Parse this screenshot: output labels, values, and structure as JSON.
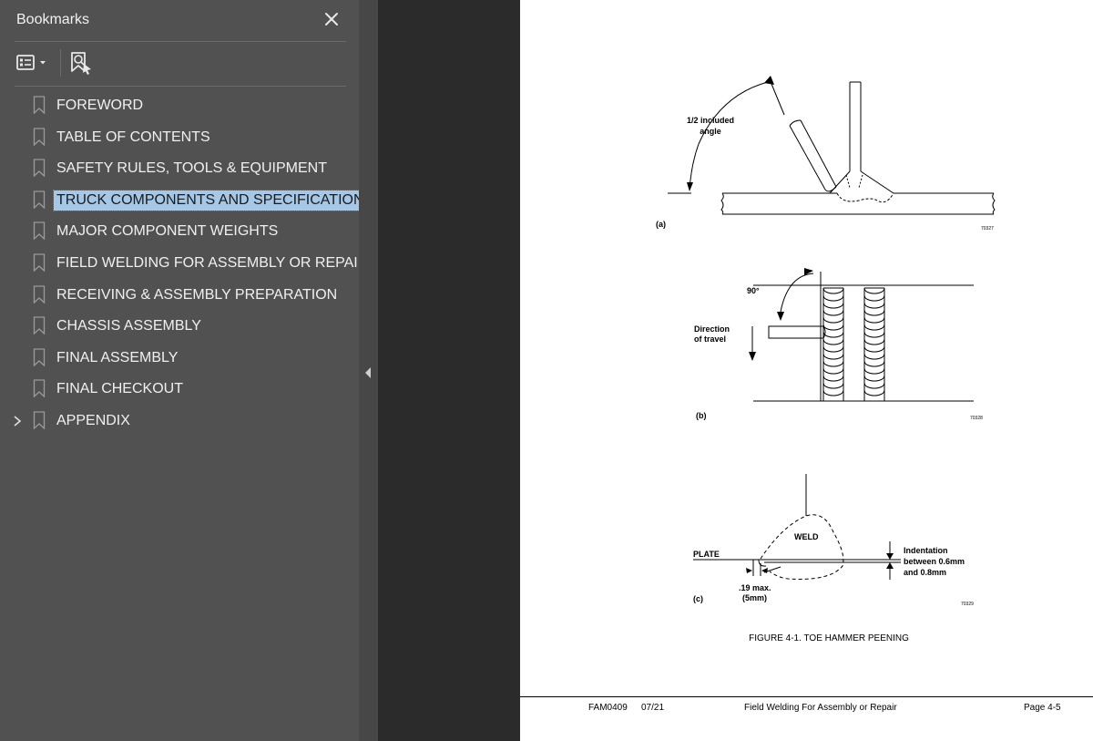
{
  "sidebar": {
    "title": "Bookmarks",
    "items": [
      {
        "label": "FOREWORD"
      },
      {
        "label": "TABLE OF CONTENTS"
      },
      {
        "label": "SAFETY RULES, TOOLS & EQUIPMENT"
      },
      {
        "label": "TRUCK COMPONENTS AND SPECIFICATIONS",
        "selected": true
      },
      {
        "label": "MAJOR COMPONENT WEIGHTS"
      },
      {
        "label": "FIELD WELDING FOR ASSEMBLY OR REPAIR"
      },
      {
        "label": "RECEIVING & ASSEMBLY PREPARATION"
      },
      {
        "label": "CHASSIS ASSEMBLY"
      },
      {
        "label": "FINAL ASSEMBLY"
      },
      {
        "label": "FINAL CHECKOUT"
      },
      {
        "label": "APPENDIX",
        "expandable": true
      }
    ]
  },
  "page": {
    "fig_a": {
      "angle_label_1": "1/2 included",
      "angle_label_2": "angle",
      "letter": "(a)",
      "code": "70327"
    },
    "fig_b": {
      "angle_label": "90°",
      "dir_label_1": "Direction",
      "dir_label_2": "of travel",
      "letter": "(b)",
      "code": "70328"
    },
    "fig_c": {
      "weld_label": "WELD",
      "plate_label": "PLATE",
      "indent_1": "Indentation",
      "indent_2": "between 0.6mm",
      "indent_3": "and 0.8mm",
      "max_1": ".19 max.",
      "max_2": "(5mm)",
      "letter": "(c)",
      "code": "70329"
    },
    "caption": "FIGURE 4-1. TOE HAMMER PEENING",
    "footer": {
      "doc_id": "FAM0409",
      "date": "07/21",
      "section": "Field Welding For Assembly or Repair",
      "page_num": "Page 4-5"
    }
  },
  "colors": {
    "sidebar_bg": "#515151",
    "selection": "#a6c8e6",
    "viewer_bg": "#2b2b2b"
  },
  "icons": [
    "close-icon",
    "bookmark-options-icon",
    "find-bookmark-icon",
    "bookmark-icon",
    "chevron-right-icon",
    "collapse-arrow-icon"
  ]
}
